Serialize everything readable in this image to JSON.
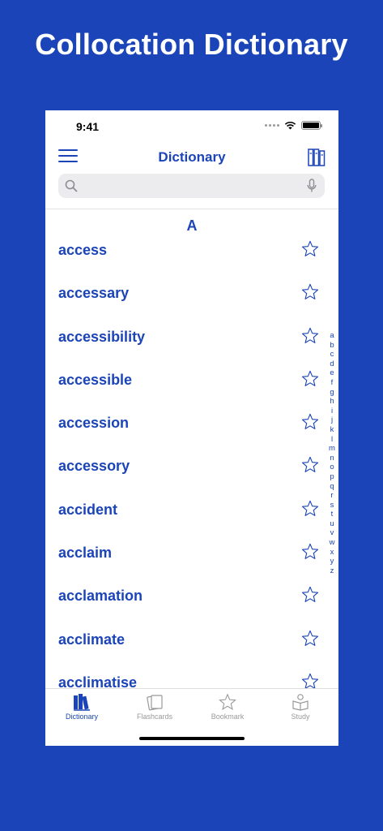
{
  "promo": {
    "title": "Collocation Dictionary"
  },
  "status_bar": {
    "time": "9:41"
  },
  "nav": {
    "title": "Dictionary"
  },
  "search": {
    "value": "",
    "placeholder": ""
  },
  "section": {
    "letter": "A"
  },
  "words": [
    "access",
    "accessary",
    "accessibility",
    "accessible",
    "accession",
    "accessory",
    "accident",
    "acclaim",
    "acclamation",
    "acclimate",
    "acclimatise"
  ],
  "index_letters": [
    "a",
    "b",
    "c",
    "d",
    "e",
    "f",
    "g",
    "h",
    "i",
    "j",
    "k",
    "l",
    "m",
    "n",
    "o",
    "p",
    "q",
    "r",
    "s",
    "t",
    "u",
    "v",
    "w",
    "x",
    "y",
    "z"
  ],
  "tabs": [
    {
      "label": "Dictionary",
      "icon": "books-icon",
      "active": true
    },
    {
      "label": "Flashcards",
      "icon": "flashcards-icon",
      "active": false
    },
    {
      "label": "Bookmark",
      "icon": "star-icon",
      "active": false
    },
    {
      "label": "Study",
      "icon": "study-icon",
      "active": false
    }
  ],
  "colors": {
    "accent": "#1a44b8",
    "background": "#1a44b8",
    "inactive": "#999999"
  }
}
